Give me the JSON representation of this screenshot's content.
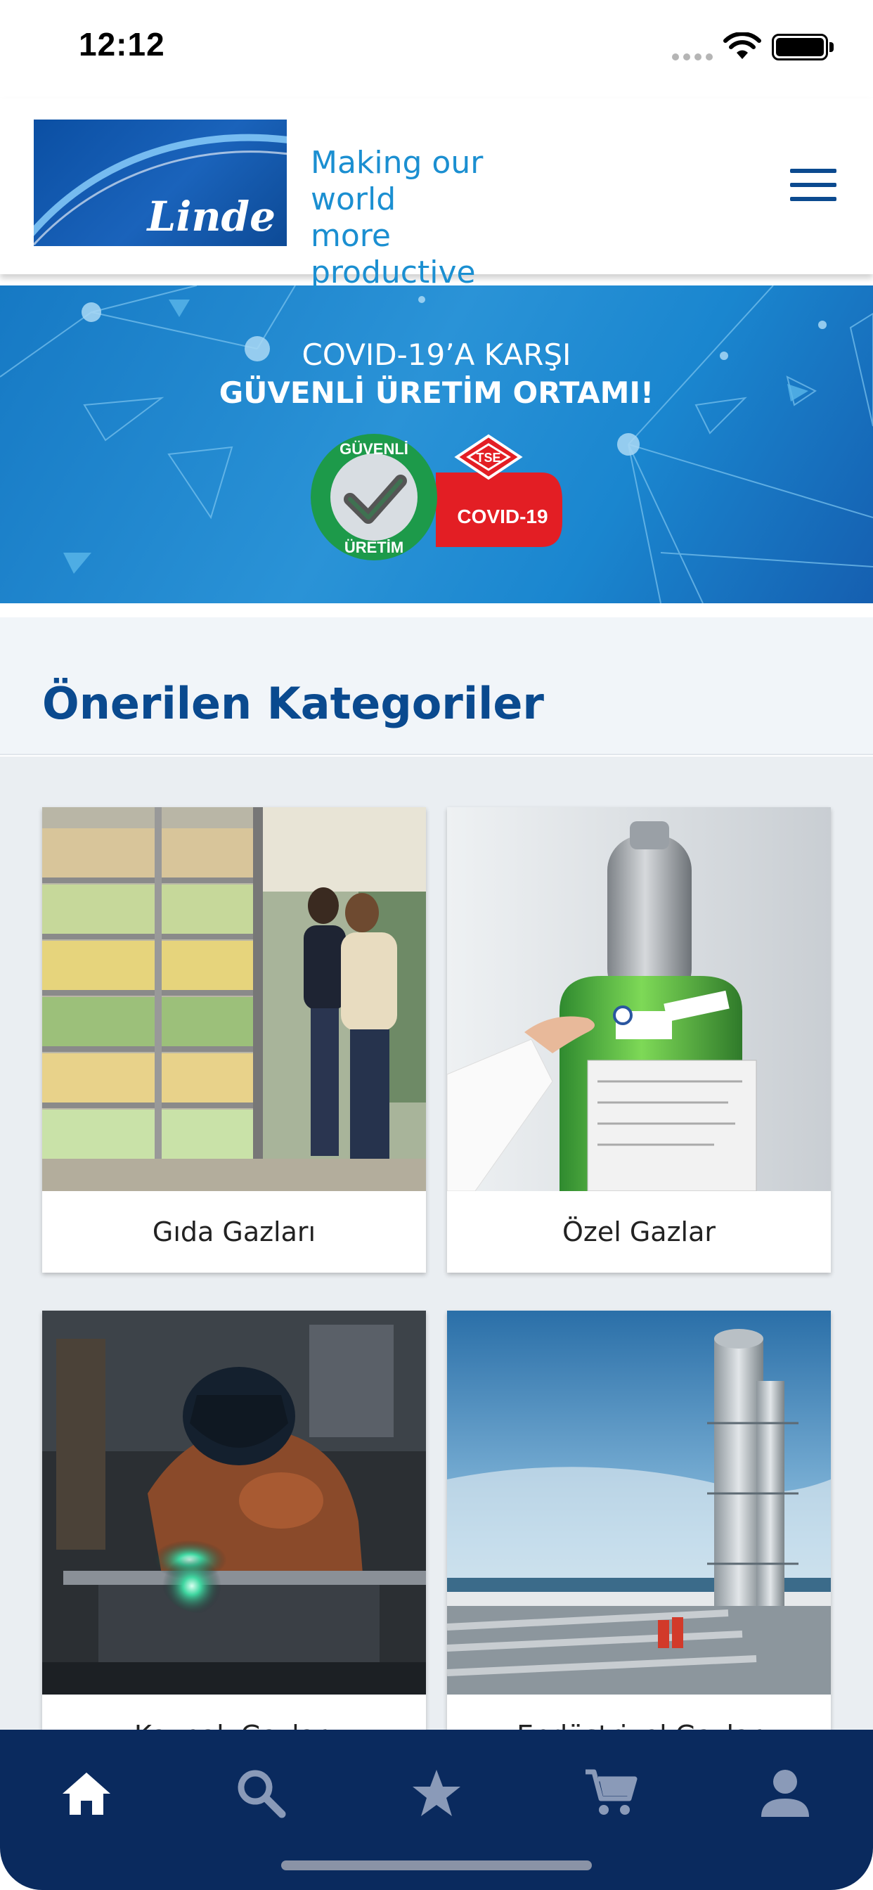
{
  "status_bar": {
    "time": "12:12"
  },
  "header": {
    "logo_text": "Linde",
    "tagline_line1": "Making our world",
    "tagline_line2": "more productive"
  },
  "banner": {
    "line1": "COVID-19’A KARŞI",
    "line2": "GÜVENLİ ÜRETİM ORTAMI!",
    "badge_left_top": "GÜVENLİ",
    "badge_left_bottom": "ÜRETİM",
    "badge_right_brand": "TSE",
    "badge_right_text": "COVID-19"
  },
  "section": {
    "title": "Önerilen Kategoriler"
  },
  "categories": [
    {
      "label": "Gıda Gazları"
    },
    {
      "label": "Özel Gazlar"
    },
    {
      "label": "Kaynak Gazları"
    },
    {
      "label": "Endüstriyel Gazlar"
    }
  ],
  "tabs": [
    {
      "icon": "home-icon",
      "active": true
    },
    {
      "icon": "search-icon",
      "active": false
    },
    {
      "icon": "star-icon",
      "active": false
    },
    {
      "icon": "cart-icon",
      "active": false
    },
    {
      "icon": "profile-icon",
      "active": false
    }
  ],
  "colors": {
    "brand_blue": "#0a4a8f",
    "tagline_blue": "#1b8fd1",
    "tabbar_bg": "#0a2a5e",
    "tab_active": "#ffffff",
    "tab_inactive": "#8a9ab8"
  }
}
